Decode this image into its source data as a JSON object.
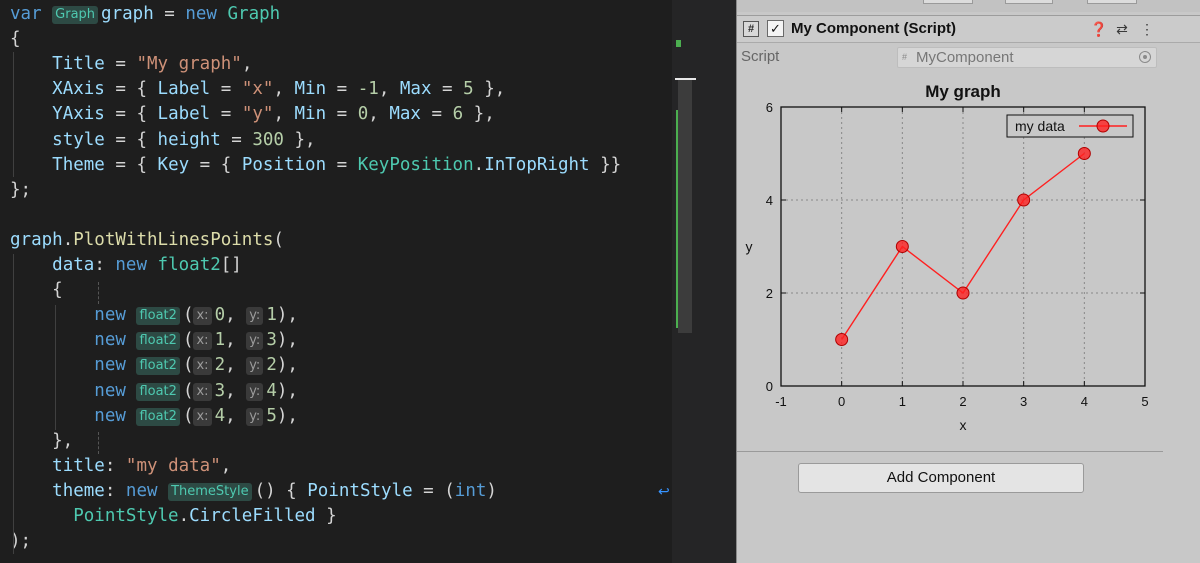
{
  "editor": {
    "lines": [
      [
        [
          "kw",
          "var "
        ],
        [
          "hint-t",
          "Graph"
        ],
        [
          "vr",
          "graph"
        ],
        [
          "pl",
          " = "
        ],
        [
          "kw",
          "new "
        ],
        [
          "ty",
          "Graph"
        ]
      ],
      [
        [
          "pl",
          "{"
        ]
      ],
      [
        [
          "pl",
          "    "
        ],
        [
          "vr",
          "Title"
        ],
        [
          "pl",
          " = "
        ],
        [
          "st",
          "\"My graph\""
        ],
        [
          "pl",
          ","
        ]
      ],
      [
        [
          "pl",
          "    "
        ],
        [
          "vr",
          "XAxis"
        ],
        [
          "pl",
          " = { "
        ],
        [
          "vr",
          "Label"
        ],
        [
          "pl",
          " = "
        ],
        [
          "st",
          "\"x\""
        ],
        [
          "pl",
          ", "
        ],
        [
          "vr",
          "Min"
        ],
        [
          "pl",
          " = "
        ],
        [
          "nm",
          "-1"
        ],
        [
          "pl",
          ", "
        ],
        [
          "vr",
          "Max"
        ],
        [
          "pl",
          " = "
        ],
        [
          "nm",
          "5"
        ],
        [
          "pl",
          " },"
        ]
      ],
      [
        [
          "pl",
          "    "
        ],
        [
          "vr",
          "YAxis"
        ],
        [
          "pl",
          " = { "
        ],
        [
          "vr",
          "Label"
        ],
        [
          "pl",
          " = "
        ],
        [
          "st",
          "\"y\""
        ],
        [
          "pl",
          ", "
        ],
        [
          "vr",
          "Min"
        ],
        [
          "pl",
          " = "
        ],
        [
          "nm",
          "0"
        ],
        [
          "pl",
          ", "
        ],
        [
          "vr",
          "Max"
        ],
        [
          "pl",
          " = "
        ],
        [
          "nm",
          "6"
        ],
        [
          "pl",
          " },"
        ]
      ],
      [
        [
          "pl",
          "    "
        ],
        [
          "vr",
          "style"
        ],
        [
          "pl",
          " = { "
        ],
        [
          "vr",
          "height"
        ],
        [
          "pl",
          " = "
        ],
        [
          "nm",
          "300"
        ],
        [
          "pl",
          " },"
        ]
      ],
      [
        [
          "pl",
          "    "
        ],
        [
          "vr",
          "Theme"
        ],
        [
          "pl",
          " = { "
        ],
        [
          "vr",
          "Key"
        ],
        [
          "pl",
          " = { "
        ],
        [
          "vr",
          "Position"
        ],
        [
          "pl",
          " = "
        ],
        [
          "ty",
          "KeyPosition"
        ],
        [
          "pl",
          "."
        ],
        [
          "vr",
          "InTopRight"
        ],
        [
          "pl",
          " }}"
        ]
      ],
      [
        [
          "pl",
          "};"
        ]
      ],
      [],
      [
        [
          "vr",
          "graph"
        ],
        [
          "pl",
          "."
        ],
        [
          "fn",
          "PlotWithLinesPoints"
        ],
        [
          "pl",
          "("
        ]
      ],
      [
        [
          "pl",
          "    "
        ],
        [
          "vr",
          "data"
        ],
        [
          "pl",
          ": "
        ],
        [
          "kw",
          "new "
        ],
        [
          "ty",
          "float2"
        ],
        [
          "pl",
          "[]"
        ]
      ],
      [
        [
          "pl",
          "    {"
        ]
      ],
      [
        [
          "pl",
          "        "
        ],
        [
          "kw",
          "new "
        ],
        [
          "hint-t",
          "float2"
        ],
        [
          "pl",
          "("
        ],
        [
          "hint-p",
          "x:"
        ],
        [
          "nm",
          "0"
        ],
        [
          "pl",
          ", "
        ],
        [
          "hint-p",
          "y:"
        ],
        [
          "nm",
          "1"
        ],
        [
          "pl",
          "),"
        ]
      ],
      [
        [
          "pl",
          "        "
        ],
        [
          "kw",
          "new "
        ],
        [
          "hint-t",
          "float2"
        ],
        [
          "pl",
          "("
        ],
        [
          "hint-p",
          "x:"
        ],
        [
          "nm",
          "1"
        ],
        [
          "pl",
          ", "
        ],
        [
          "hint-p",
          "y:"
        ],
        [
          "nm",
          "3"
        ],
        [
          "pl",
          "),"
        ]
      ],
      [
        [
          "pl",
          "        "
        ],
        [
          "kw",
          "new "
        ],
        [
          "hint-t",
          "float2"
        ],
        [
          "pl",
          "("
        ],
        [
          "hint-p",
          "x:"
        ],
        [
          "nm",
          "2"
        ],
        [
          "pl",
          ", "
        ],
        [
          "hint-p",
          "y:"
        ],
        [
          "nm",
          "2"
        ],
        [
          "pl",
          "),"
        ]
      ],
      [
        [
          "pl",
          "        "
        ],
        [
          "kw",
          "new "
        ],
        [
          "hint-t",
          "float2"
        ],
        [
          "pl",
          "("
        ],
        [
          "hint-p",
          "x:"
        ],
        [
          "nm",
          "3"
        ],
        [
          "pl",
          ", "
        ],
        [
          "hint-p",
          "y:"
        ],
        [
          "nm",
          "4"
        ],
        [
          "pl",
          "),"
        ]
      ],
      [
        [
          "pl",
          "        "
        ],
        [
          "kw",
          "new "
        ],
        [
          "hint-t",
          "float2"
        ],
        [
          "pl",
          "("
        ],
        [
          "hint-p",
          "x:"
        ],
        [
          "nm",
          "4"
        ],
        [
          "pl",
          ", "
        ],
        [
          "hint-p",
          "y:"
        ],
        [
          "nm",
          "5"
        ],
        [
          "pl",
          "),"
        ]
      ],
      [
        [
          "pl",
          "    },"
        ]
      ],
      [
        [
          "pl",
          "    "
        ],
        [
          "vr",
          "title"
        ],
        [
          "pl",
          ": "
        ],
        [
          "st",
          "\"my data\""
        ],
        [
          "pl",
          ","
        ]
      ],
      [
        [
          "pl",
          "    "
        ],
        [
          "vr",
          "theme"
        ],
        [
          "pl",
          ": "
        ],
        [
          "kw",
          "new "
        ],
        [
          "hint-t",
          "ThemeStyle"
        ],
        [
          "pl",
          "() { "
        ],
        [
          "vr",
          "PointStyle"
        ],
        [
          "pl",
          " = ("
        ],
        [
          "kw",
          "int"
        ],
        [
          "pl",
          ")"
        ]
      ],
      [
        [
          "pl",
          "      "
        ],
        [
          "ty",
          "PointStyle"
        ],
        [
          "pl",
          "."
        ],
        [
          "vr",
          "CircleFilled"
        ],
        [
          "pl",
          " }"
        ]
      ],
      [
        [
          "pl",
          ");"
        ]
      ]
    ]
  },
  "inspector": {
    "component_title": "My Component (Script)",
    "script_icon": "#",
    "enabled_mark": "✓",
    "help_icon": "❓",
    "presets_icon": "⇄",
    "menu_icon": "⋮",
    "script_label": "Script",
    "script_value": "MyComponent",
    "add_component_label": "Add Component"
  },
  "chart_data": {
    "type": "line",
    "title": "My graph",
    "xlabel": "x",
    "ylabel": "y",
    "xlim": [
      -1,
      5
    ],
    "ylim": [
      0,
      6
    ],
    "xticks": [
      -1,
      0,
      1,
      2,
      3,
      4,
      5
    ],
    "yticks": [
      0,
      2,
      4,
      6
    ],
    "grid": true,
    "legend_position": "top-right",
    "series": [
      {
        "name": "my data",
        "x": [
          0,
          1,
          2,
          3,
          4
        ],
        "y": [
          1,
          3,
          2,
          4,
          5
        ],
        "color": "#ff2020",
        "marker": "circle-filled"
      }
    ]
  }
}
